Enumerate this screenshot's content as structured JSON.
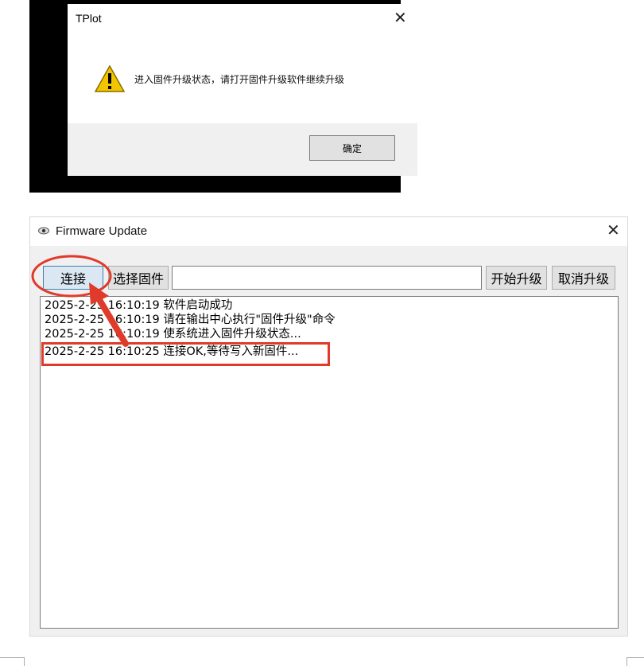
{
  "message_box": {
    "title": "TPlot",
    "close_glyph": "✕",
    "icon": "warning-icon",
    "message": "进入固件升级状态，请打开固件升级软件继续升级",
    "ok_label": "确定"
  },
  "firmware_window": {
    "title": "Firmware Update",
    "app_icon": "eye-icon",
    "close_glyph": "✕",
    "buttons": {
      "connect": "连接",
      "select_firmware": "选择固件",
      "start_upgrade": "开始升级",
      "cancel_upgrade": "取消升级"
    },
    "file_path": "",
    "log": [
      "2025-2-25 16:10:19 软件启动成功",
      "2025-2-25 16:10:19 请在输出中心执行\"固件升级\"命令",
      "2025-2-25 16:10:19 使系统进入固件升级状态...",
      "2025-2-25 16:10:25 连接OK,等待写入新固件..."
    ]
  },
  "colors": {
    "annotation_red": "#e03a2a",
    "window_bg": "#f0f0f0",
    "button_bg": "#e1e1e1",
    "warning_yellow": "#f2c500"
  }
}
